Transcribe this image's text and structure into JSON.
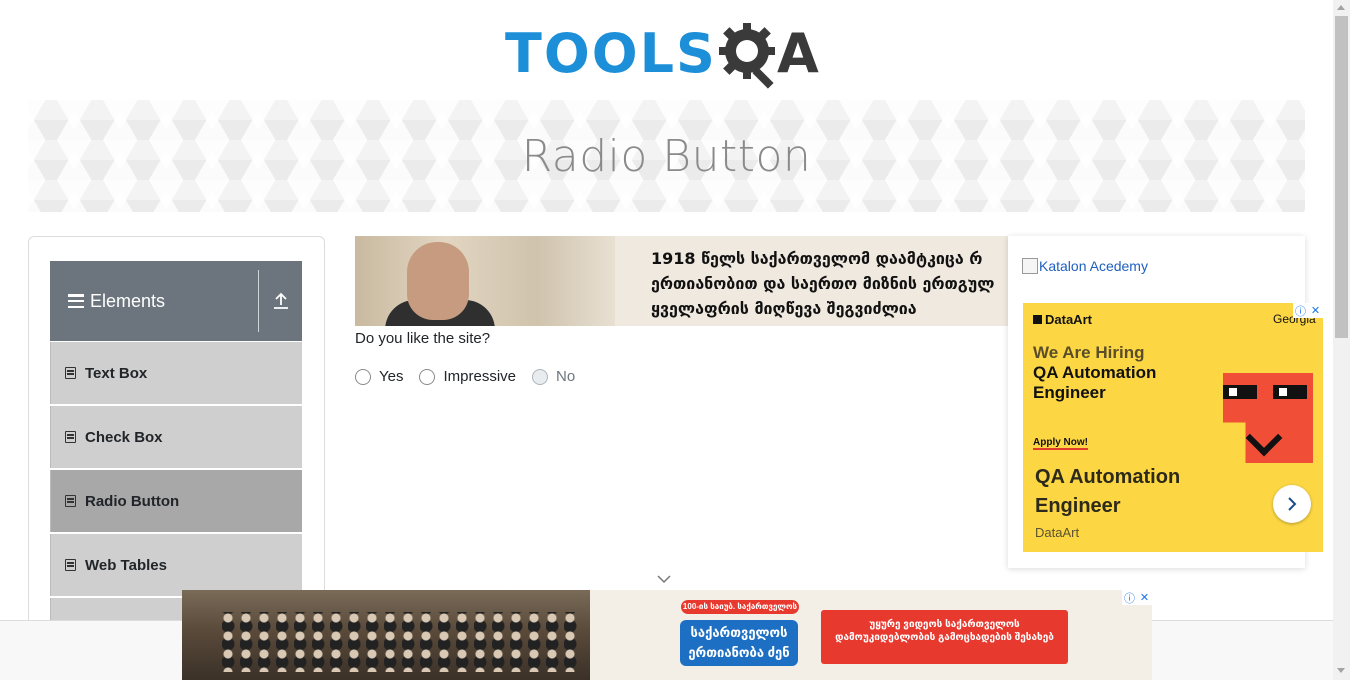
{
  "header": {
    "logo_text": "TOOLS",
    "logo_suffix": "A",
    "logo_colors": {
      "primary": "#1d8fd8",
      "secondary": "#3a3a3a"
    }
  },
  "page": {
    "title": "Radio Button"
  },
  "sidebar": {
    "group_title": "Elements",
    "items": [
      {
        "label": "Text Box",
        "active": false
      },
      {
        "label": "Check Box",
        "active": false
      },
      {
        "label": "Radio Button",
        "active": true
      },
      {
        "label": "Web Tables",
        "active": false
      }
    ]
  },
  "ad_top": {
    "lines": [
      "1918 წელს საქართველომ დაამტკიცა რ",
      "ერთიანობით და საერთო მიზნის ერთგულ",
      "ყველაფრის მიღწევა შეგვიძლია"
    ]
  },
  "form": {
    "question": "Do you like the site?",
    "options": [
      {
        "label": "Yes",
        "disabled": false
      },
      {
        "label": "Impressive",
        "disabled": false
      },
      {
        "label": "No",
        "disabled": true
      }
    ]
  },
  "right_ad": {
    "katalon_alt": "Katalon Acedemy",
    "brand": "DataArt",
    "country": "Georgia",
    "hiring": "We Are Hiring",
    "role": "QA Automation Engineer",
    "apply": "Apply Now!",
    "headline": "QA Automation Engineer",
    "source": "DataArt",
    "colors": {
      "background": "#fcd743",
      "accent": "#f04e37"
    }
  },
  "bottom_ad": {
    "badge_top": "100-ის საიუბ. საქართველოს",
    "badge_main": "საქართველოს ერთიანობა ძენ",
    "cta": "უყურე ვიდეოს საქართველოს დამოუკიდებლობის გამოცხადების შესახებ"
  }
}
